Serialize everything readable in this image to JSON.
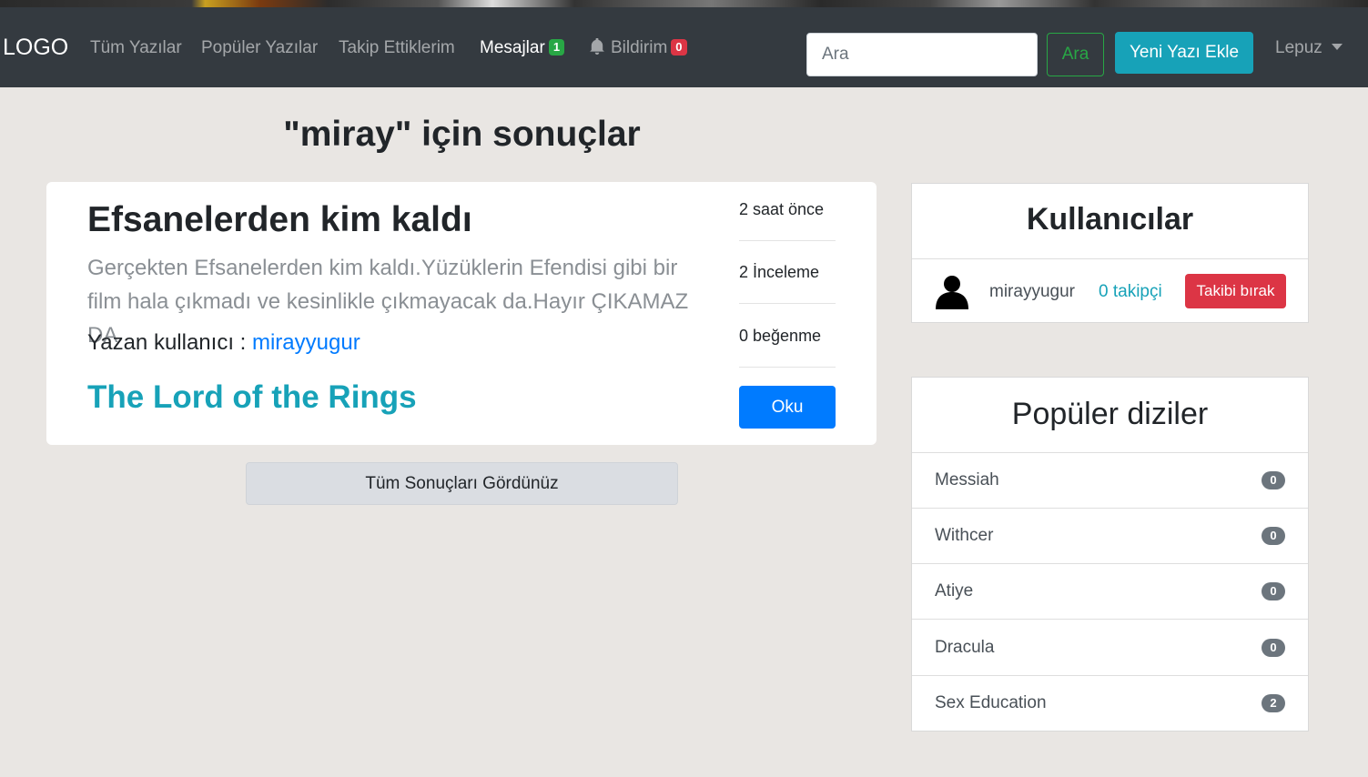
{
  "navbar": {
    "brand": "LOGO",
    "links": [
      {
        "label": "Tüm Yazılar"
      },
      {
        "label": "Popüler Yazılar"
      },
      {
        "label": "Takip Ettiklerim"
      },
      {
        "label": "Mesajlar",
        "badge": "1"
      },
      {
        "label": "Bildirim",
        "badge": "0"
      }
    ],
    "search_placeholder": "Ara",
    "search_button": "Ara",
    "new_post_button": "Yeni Yazı Ekle",
    "user_menu": "Lepuz"
  },
  "results_title": "\"miray\" için sonuçlar",
  "post": {
    "title": "Efsanelerden kim kaldı",
    "excerpt": "Gerçekten Efsanelerden kim kaldı.Yüzüklerin Efendisi gibi bir film hala çıkmadı ve kesinlikle çıkmayacak da.Hayır ÇIKAMAZ DA",
    "author_label": "Yazan kullanıcı : ",
    "author": "mirayyugur",
    "show": "The Lord of the Rings",
    "time": "2 saat önce",
    "reviews": "2 İnceleme",
    "likes": "0 beğenme",
    "read_button": "Oku"
  },
  "all_results_seen": "Tüm Sonuçları Gördünüz",
  "users_panel": {
    "title": "Kullanıcılar",
    "user": {
      "name": "mirayyugur",
      "followers": "0 takipçi",
      "action": "Takibi bırak"
    }
  },
  "series_panel": {
    "title": "Popüler diziler",
    "items": [
      {
        "name": "Messiah",
        "count": "0"
      },
      {
        "name": "Withcer",
        "count": "0"
      },
      {
        "name": "Atiye",
        "count": "0"
      },
      {
        "name": "Dracula",
        "count": "0"
      },
      {
        "name": "Sex Education",
        "count": "2"
      }
    ]
  },
  "colors": {
    "navbar": "#343a40",
    "primary": "#007bff",
    "info": "#17a2b8",
    "success": "#28a745",
    "danger": "#dc3545",
    "background": "#e9e6e3"
  },
  "icons": {
    "notification": "bell-icon",
    "avatar": "user-silhouette-icon",
    "dropdown": "caret-down-icon"
  }
}
